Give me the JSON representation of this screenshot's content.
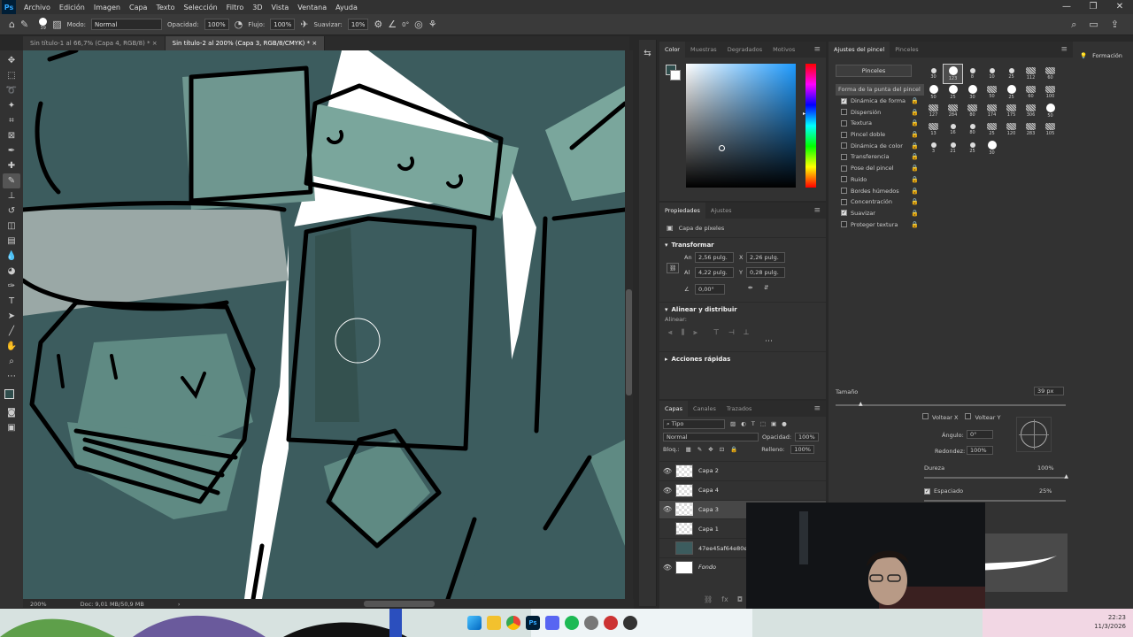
{
  "menu": [
    "Archivo",
    "Edición",
    "Imagen",
    "Capa",
    "Texto",
    "Selección",
    "Filtro",
    "3D",
    "Vista",
    "Ventana",
    "Ayuda"
  ],
  "options": {
    "modo_label": "Modo:",
    "modo": "Normal",
    "opacidad_label": "Opacidad:",
    "opacidad": "100%",
    "flujo_label": "Flujo:",
    "flujo": "100%",
    "suavizar_label": "Suavizar:",
    "suavizar": "10%",
    "angle": "0°",
    "brush_size": "39"
  },
  "tabs": [
    "Sin título-1 al 66,7% (Capa 4, RGB/8) *",
    "Sin título-2 al 200% (Capa 3, RGB/8/CMYK) *"
  ],
  "status": {
    "zoom": "200%",
    "doc": "Doc: 9,01 MB/50,9 MB"
  },
  "color_panel": {
    "tabs": [
      "Color",
      "Muestras",
      "Degradados",
      "Motivos"
    ]
  },
  "properties": {
    "tabs": [
      "Propiedades",
      "Ajustes"
    ],
    "layer_type": "Capa de píxeles",
    "transform_title": "Transformar",
    "an_label": "An",
    "an": "2,56 pulg.",
    "x_label": "X",
    "x": "2,26 pulg.",
    "al_label": "Al",
    "al": "4,22 pulg.",
    "y_label": "Y",
    "y": "0,28 pulg.",
    "angle": "0,00°",
    "align_title": "Alinear y distribuir",
    "align_label": "Alinear:",
    "quick_title": "Acciones rápidas"
  },
  "layers_panel": {
    "tabs": [
      "Capas",
      "Canales",
      "Trazados"
    ],
    "kind": "Tipo",
    "blend": "Normal",
    "opacity_label": "Opacidad:",
    "opacity": "100%",
    "lock_label": "Bloq.:",
    "fill_label": "Relleno:",
    "fill": "100%",
    "layers": [
      {
        "name": "Capa 2",
        "visible": true,
        "selected": false
      },
      {
        "name": "Capa 4",
        "visible": true,
        "selected": false
      },
      {
        "name": "Capa 3",
        "visible": true,
        "selected": true
      },
      {
        "name": "Capa 1",
        "visible": false,
        "selected": false
      },
      {
        "name": "47ee45af64e80e6",
        "visible": false,
        "selected": false
      },
      {
        "name": "Fondo",
        "visible": true,
        "selected": false
      }
    ]
  },
  "brush_settings": {
    "tabs": [
      "Ajustes del pincel",
      "Pinceles"
    ],
    "pinceles_button": "Pinceles",
    "options": [
      {
        "label": "Forma de la punta del pincel",
        "check": null,
        "active": true
      },
      {
        "label": "Dinámica de forma",
        "check": true
      },
      {
        "label": "Dispersión",
        "check": false
      },
      {
        "label": "Textura",
        "check": false
      },
      {
        "label": "Pincel doble",
        "check": false
      },
      {
        "label": "Dinámica de color",
        "check": false
      },
      {
        "label": "Transferencia",
        "check": false
      },
      {
        "label": "Pose del pincel",
        "check": false
      },
      {
        "label": "Ruido",
        "check": false
      },
      {
        "label": "Bordes húmedos",
        "check": false
      },
      {
        "label": "Concentración",
        "check": false
      },
      {
        "label": "Suavizar",
        "check": true
      },
      {
        "label": "Proteger textura",
        "check": false
      }
    ],
    "presets": [
      "30",
      "123",
      "8",
      "10",
      "25",
      "112",
      "60",
      "50",
      "25",
      "30",
      "50",
      "25",
      "60",
      "100",
      "127",
      "284",
      "80",
      "174",
      "175",
      "306",
      "50",
      "13",
      "16",
      "80",
      "25",
      "120",
      "283",
      "105",
      "3",
      "21",
      "25",
      "30"
    ],
    "tamano_label": "Tamaño",
    "tamano": "39 px",
    "voltear_x": "Voltear X",
    "voltear_y": "Voltear Y",
    "angulo_label": "Ángulo:",
    "angulo": "0°",
    "redondez_label": "Redondez:",
    "redondez": "100%",
    "dureza_label": "Dureza",
    "dureza": "100%",
    "espaciado_label": "Espaciado",
    "espaciado": "25%"
  },
  "learn": "Formación",
  "clock": {
    "time": "22:23",
    "date": "11/3/2026"
  },
  "colors": {
    "teal_dark": "#3c5c5e",
    "teal_light": "#5f8a83",
    "teal_mid": "#34514f",
    "ps_blue": "#31a8ff"
  }
}
